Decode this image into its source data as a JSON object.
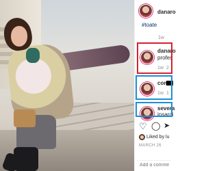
{
  "post": {
    "username": "danaro",
    "hashtag": "#toate",
    "time_top": "1w"
  },
  "comments": [
    {
      "username": "danaro",
      "text": "profes",
      "time": "1w",
      "likes": "2"
    },
    {
      "username": "comi",
      "text": "",
      "time": "1w",
      "likes": "1"
    },
    {
      "username": "severa",
      "text": "insarci",
      "time": "",
      "likes": ""
    }
  ],
  "actions": {
    "like_icon": "heart-icon",
    "comment_icon": "comment-icon",
    "share_icon": "paper-plane-icon",
    "liked_by": "Liked by lu",
    "date": "MARCH 26"
  },
  "comment_box": {
    "placeholder": "Add a comme"
  },
  "colors": {
    "highlight_red": "#d6202f",
    "highlight_blue": "#1a8fd6",
    "link": "#00376b"
  }
}
